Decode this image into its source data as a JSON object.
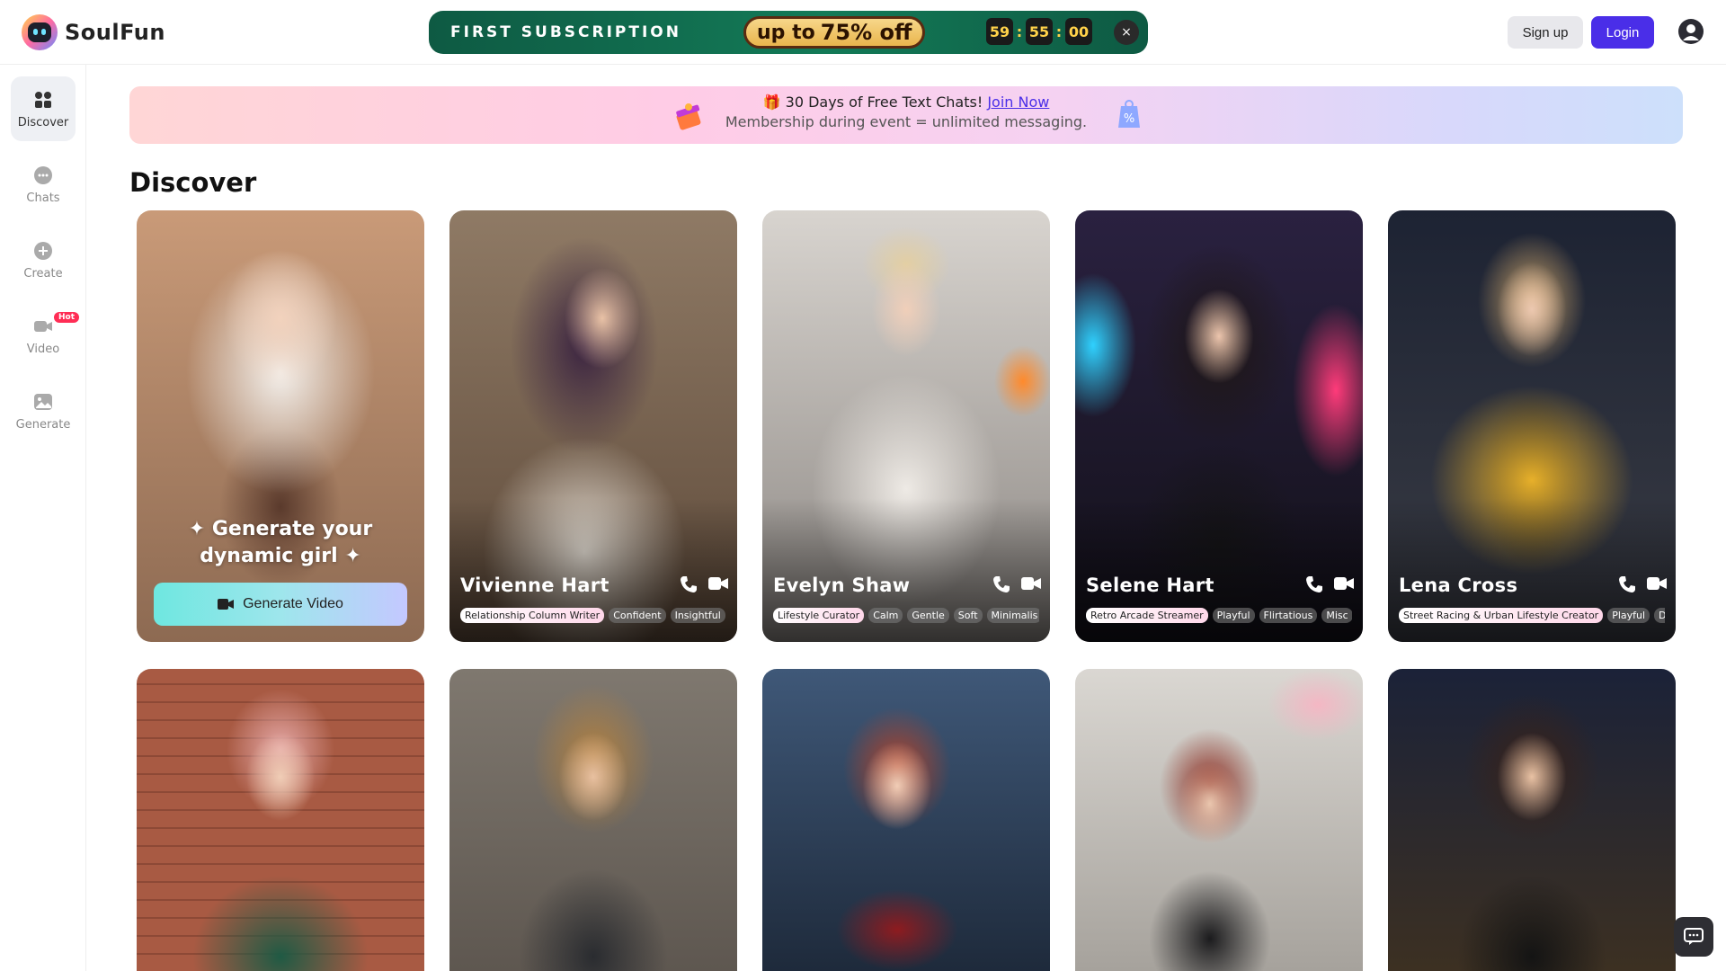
{
  "app": {
    "name": "SoulFun"
  },
  "promo": {
    "title": "FIRST SUBSCRIPTION",
    "offer_prefix": "up to",
    "offer_value": "75% off",
    "countdown": {
      "hours": "59",
      "minutes": "55",
      "seconds": "00",
      "separator": ":"
    },
    "close": "×"
  },
  "auth": {
    "signup": "Sign up",
    "login": "Login"
  },
  "sidebar": {
    "items": [
      {
        "label": "Discover",
        "icon": "grid-icon"
      },
      {
        "label": "Chats",
        "icon": "chat-bubble-icon"
      },
      {
        "label": "Create",
        "icon": "plus-circle-icon"
      },
      {
        "label": "Video",
        "icon": "video-camera-icon",
        "badge": "Hot"
      },
      {
        "label": "Generate",
        "icon": "image-icon"
      }
    ]
  },
  "banner": {
    "line1_prefix": "🎁 30 Days of Free Text Chats!",
    "line1_link": "Join Now",
    "line2": "Membership during event = unlimited messaging."
  },
  "page": {
    "title": "Discover"
  },
  "generate_card": {
    "line1": "✦ Generate your",
    "line2": "dynamic girl ✦",
    "button": "Generate Video"
  },
  "cards": [
    {
      "name": "Vivienne Hart",
      "tags": [
        "Relationship Column Writer",
        "Confident",
        "Insightful"
      ]
    },
    {
      "name": "Evelyn Shaw",
      "tags": [
        "Lifestyle Curator",
        "Calm",
        "Gentle",
        "Soft",
        "Minimalis"
      ]
    },
    {
      "name": "Selene Hart",
      "tags": [
        "Retro Arcade Streamer",
        "Playful",
        "Flirtatious",
        "Misc"
      ]
    },
    {
      "name": "Lena Cross",
      "tags": [
        "Street Racing & Urban Lifestyle Creator",
        "Playful",
        "D"
      ]
    }
  ],
  "colors": {
    "accent": "#4a2ee8",
    "promo_bg": "#137a57",
    "countdown": "#ffd24a"
  }
}
